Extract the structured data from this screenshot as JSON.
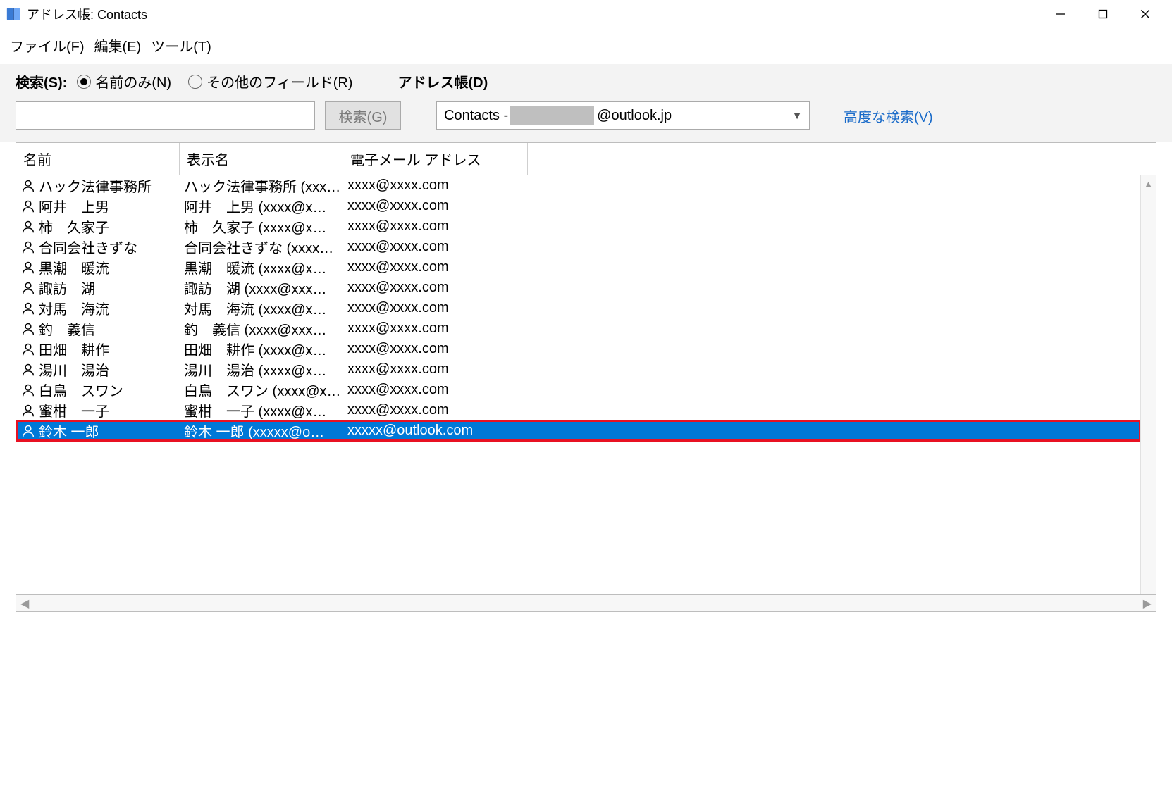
{
  "window": {
    "title": "アドレス帳: Contacts"
  },
  "menu": {
    "file": "ファイル(F)",
    "edit": "編集(E)",
    "tool": "ツール(T)"
  },
  "search": {
    "label": "検索(S):",
    "radio_name_only": "名前のみ(N)",
    "radio_more_fields": "その他のフィールド(R)",
    "selected_radio": "name_only",
    "button": "検索(G)",
    "input_value": ""
  },
  "address_book": {
    "label": "アドレス帳(D)",
    "selected_prefix": "Contacts - ",
    "selected_suffix": "@outlook.jp"
  },
  "advanced_search": "高度な検索(V)",
  "columns": {
    "name": "名前",
    "display": "表示名",
    "email": "電子メール アドレス"
  },
  "contacts": [
    {
      "name": "ハック法律事務所",
      "display": "ハック法律事務所 (xxx…",
      "email": "xxxx@xxxx.com",
      "selected": false
    },
    {
      "name": "阿井　上男",
      "display": "阿井　上男 (xxxx@x…",
      "email": "xxxx@xxxx.com",
      "selected": false
    },
    {
      "name": "柿　久家子",
      "display": "柿　久家子 (xxxx@x…",
      "email": "xxxx@xxxx.com",
      "selected": false
    },
    {
      "name": "合同会社きずな",
      "display": "合同会社きずな (xxxx…",
      "email": "xxxx@xxxx.com",
      "selected": false
    },
    {
      "name": "黒潮　暖流",
      "display": "黒潮　暖流 (xxxx@x…",
      "email": "xxxx@xxxx.com",
      "selected": false
    },
    {
      "name": "諏訪　湖",
      "display": "諏訪　湖 (xxxx@xxx…",
      "email": "xxxx@xxxx.com",
      "selected": false
    },
    {
      "name": "対馬　海流",
      "display": "対馬　海流 (xxxx@x…",
      "email": "xxxx@xxxx.com",
      "selected": false
    },
    {
      "name": "釣　義信",
      "display": "釣　義信 (xxxx@xxx…",
      "email": "xxxx@xxxx.com",
      "selected": false
    },
    {
      "name": "田畑　耕作",
      "display": "田畑　耕作 (xxxx@x…",
      "email": "xxxx@xxxx.com",
      "selected": false
    },
    {
      "name": "湯川　湯治",
      "display": "湯川　湯治 (xxxx@x…",
      "email": "xxxx@xxxx.com",
      "selected": false
    },
    {
      "name": "白鳥　スワン",
      "display": "白鳥　スワン (xxxx@x…",
      "email": "xxxx@xxxx.com",
      "selected": false
    },
    {
      "name": "蜜柑　一子",
      "display": "蜜柑　一子 (xxxx@x…",
      "email": "xxxx@xxxx.com",
      "selected": false
    },
    {
      "name": "鈴木 一郎",
      "display": "鈴木 一郎 (xxxxx@o…",
      "email": "xxxxx@outlook.com",
      "selected": true,
      "highlighted": true
    }
  ]
}
